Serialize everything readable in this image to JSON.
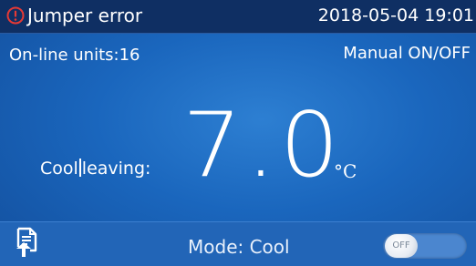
{
  "status_bar": {
    "alert_icon": "exclamation-circle-icon",
    "alert_color": "#e53935",
    "alert_text": "Jumper error",
    "datetime": "2018-05-04 19:01"
  },
  "info": {
    "online_units_label": "On-line units:",
    "online_units_value": "16",
    "manual_control_label": "Manual ON/OFF"
  },
  "temperature": {
    "label_part1": "Cool",
    "label_part2": "leaving:",
    "value": "7.0",
    "unit": "°C"
  },
  "bottom_bar": {
    "exit_icon": "exit-document-icon",
    "mode_text": "Mode: Cool",
    "toggle_label": "OFF",
    "toggle_state": "off"
  },
  "colors": {
    "background": "#1a66bd",
    "top_bar": "#0f2f63",
    "bottom_bar": "#2265b7"
  }
}
